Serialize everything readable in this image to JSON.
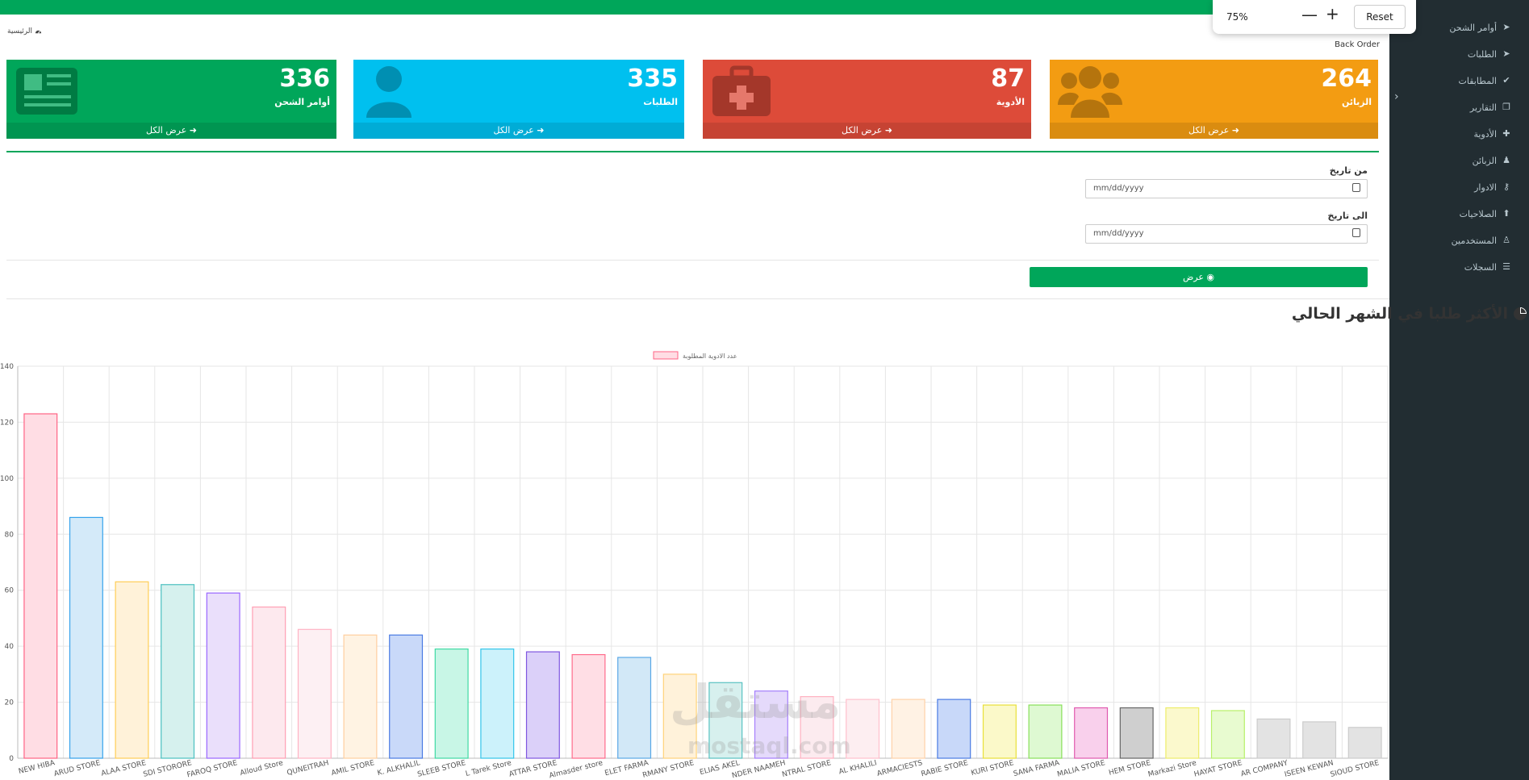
{
  "zoom": {
    "level": "75%",
    "reset_label": "Reset"
  },
  "breadcrumb": {
    "home_label": "الرئيسية"
  },
  "page": {
    "subtitle": "Back Order"
  },
  "sidebar": {
    "items": [
      {
        "label": "أوامر الشحن",
        "icon": "paper-plane-icon"
      },
      {
        "label": "الطلبات",
        "icon": "paper-plane-icon"
      },
      {
        "label": "المطابقات",
        "icon": "check-icon"
      },
      {
        "label": "التقارير",
        "icon": "copy-icon"
      },
      {
        "label": "الأدوية",
        "icon": "medkit-icon"
      },
      {
        "label": "الزبائن",
        "icon": "users-icon"
      },
      {
        "label": "الادوار",
        "icon": "key-icon"
      },
      {
        "label": "الصلاحيات",
        "icon": "arrow-up-icon"
      },
      {
        "label": "المستخدمين",
        "icon": "user-icon"
      },
      {
        "label": "السجلات",
        "icon": "list-icon"
      }
    ]
  },
  "cards": [
    {
      "value": "336",
      "label": "أوامر الشحن",
      "footer": "عرض الكل",
      "color": "#00a65a",
      "foot_color": "#009551",
      "icon": "newspaper-icon"
    },
    {
      "value": "335",
      "label": "الطلبات",
      "footer": "عرض الكل",
      "color": "#00c0ef",
      "foot_color": "#00acd6",
      "icon": "user-doctor-icon"
    },
    {
      "value": "87",
      "label": "الأدوية",
      "footer": "عرض الكل",
      "color": "#dd4b39",
      "foot_color": "#c64333",
      "icon": "medkit-icon"
    },
    {
      "value": "264",
      "label": "الزبائن",
      "footer": "عرض الكل",
      "color": "#f39c12",
      "foot_color": "#da8c10",
      "icon": "users-icon"
    }
  ],
  "form": {
    "from_label": "من تاريخ",
    "to_label": "الى تاريخ",
    "date_placeholder": "mm/dd/yyyy",
    "show_button": "عرض"
  },
  "chart_title": "الأكثر طلبا في الشهر الحالي",
  "watermark": {
    "text": "مستقل",
    "sub": "mostaql.com"
  },
  "chart_data": {
    "type": "bar",
    "legend": "عدد الادوية المطلوبة",
    "legend_position": "top-center",
    "grid": true,
    "ylim": [
      0,
      140
    ],
    "yticks": [
      0,
      20,
      40,
      60,
      80,
      100,
      120,
      140
    ],
    "categories": [
      "NEW HIBA",
      "ARUD STORE",
      "ALAA STORE",
      "SDI STORORE",
      "FAROQ STORE",
      "Alloud Store",
      "QUNEITRAH",
      "AMIL STORE",
      "K. ALKHALIL",
      "SLEEB STORE",
      "L Tarek Store",
      "ATTAR STORE",
      "Almasder store",
      "ELET FARMA",
      "RMANY STORE",
      "ELIAS AKEL",
      "NDER NAAMEH",
      "NTRAL STORE",
      "AL KHALILI",
      "ARMACIESTS",
      "RABIE STORE",
      "KURI STORE",
      "SANA FARMA",
      "MALIA STORE",
      "HEM STORE",
      "Markazi Store",
      "HAYAT STORE",
      "AR COMPANY",
      "ISEEN KEWAN",
      "SIOUD STORE"
    ],
    "values": [
      123,
      86,
      63,
      62,
      59,
      54,
      46,
      44,
      44,
      39,
      39,
      38,
      37,
      36,
      30,
      27,
      24,
      22,
      21,
      21,
      21,
      19,
      19,
      18,
      18,
      18,
      17,
      14,
      13,
      11
    ],
    "fill_colors": [
      "#ffdde4",
      "#d4eaf9",
      "#fff2d9",
      "#d6f1ee",
      "#eadffb",
      "#fde9ee",
      "#fdf0f3",
      "#fff3e3",
      "#c9d9f9",
      "#c8f6e6",
      "#ccf2fb",
      "#dbd0f9",
      "#ffdee5",
      "#d2e8f7",
      "#fff2da",
      "#d7f0ee",
      "#e5dafb",
      "#fcebef",
      "#fdeef1",
      "#fff2e4",
      "#c8d8f9",
      "#fbf9c9",
      "#def9d2",
      "#f9d0ec",
      "#cfcfcf",
      "#fbf9cd",
      "#e8fbd0",
      "#e3e3e3",
      "#e3e3e3",
      "#e3e3e3"
    ],
    "border_colors": [
      "#ff6384",
      "#36a2eb",
      "#ffcd56",
      "#4bc0c0",
      "#9966ff",
      "#ff9fb3",
      "#ffb3c4",
      "#ffcf9f",
      "#4a7be3",
      "#3fd9a3",
      "#33c5ea",
      "#7f56e0",
      "#ff6b8b",
      "#5aa8e6",
      "#ffd37a",
      "#59c2c2",
      "#a57ffb",
      "#ffb1c1",
      "#ffc0cd",
      "#ffd2a8",
      "#4a7be3",
      "#e8e03a",
      "#89e05a",
      "#e05aaf",
      "#666666",
      "#eded6a",
      "#b8f06a",
      "#cccccc",
      "#cccccc",
      "#cccccc"
    ]
  }
}
